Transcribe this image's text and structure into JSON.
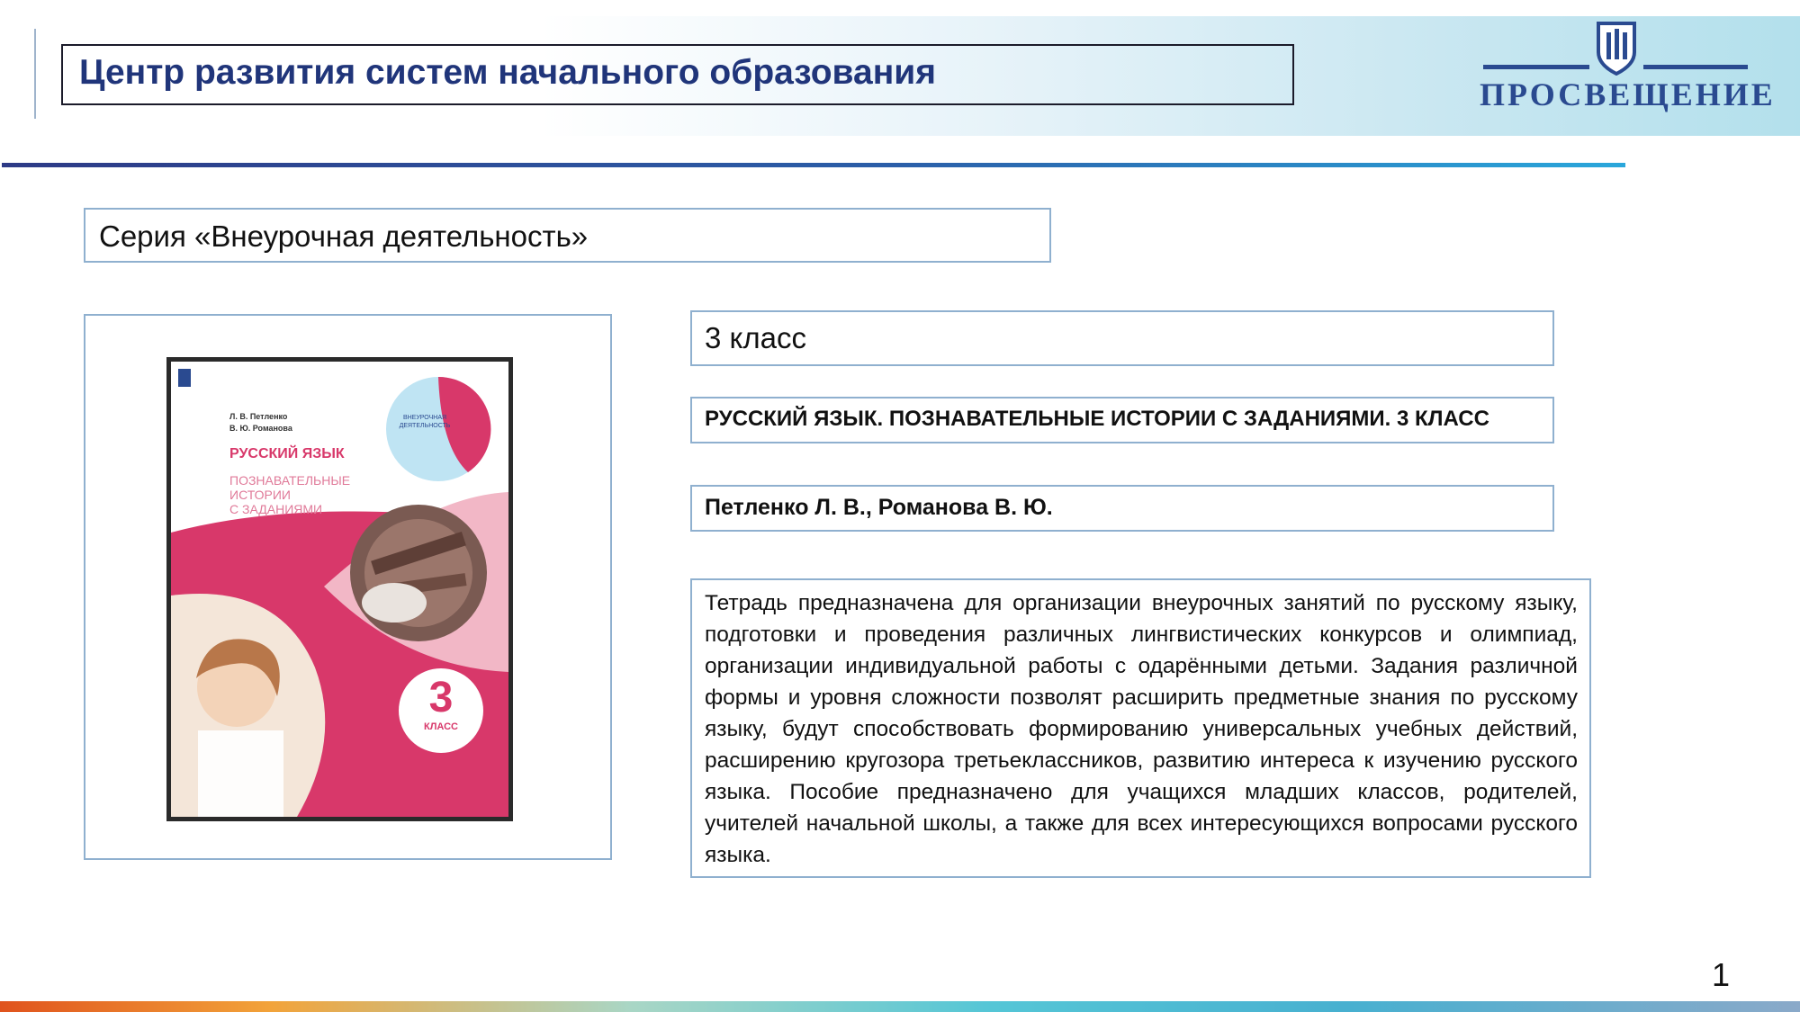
{
  "header": {
    "title": "Центр развития систем начального образования",
    "logo_text": "ПРОСВЕЩЕНИЕ"
  },
  "series": {
    "label": "Серия «Внеурочная деятельность»"
  },
  "book": {
    "grade": "3 класс",
    "title": "РУССКИЙ ЯЗЫК. ПОЗНАВАТЕЛЬНЫЕ ИСТОРИИ С ЗАДАНИЯМИ. 3 КЛАСС",
    "authors": "Петленко Л. В., Романова В. Ю.",
    "description": "Тетрадь предназначена для организации внеурочных занятий по русскому языку, подготовки и проведения различных лингвистических конкурсов и олимпиад, организации индивидуальной работы с одарёнными детьми. Задания различной формы и уровня сложности позволят расширить предметные знания по русскому языку, будут способствовать формированию универсальных учебных действий, расширению кругозора третьеклассников, развитию интереса к изучению русского языка. Пособие предназначено для учащихся младших классов, родителей, учителей начальной школы, а также для всех интересующихся вопросами русского языка."
  },
  "cover": {
    "authors_line1": "Л. В. Петленко",
    "authors_line2": "В. Ю. Романова",
    "subject": "РУССКИЙ ЯЗЫК",
    "subtitle_line1": "ПОЗНАВАТЕЛЬНЫЕ",
    "subtitle_line2": "ИСТОРИИ",
    "subtitle_line3": "С ЗАДАНИЯМИ",
    "badge_line1": "ВНЕУРОЧНАЯ",
    "badge_line2": "ДЕЯТЕЛЬНОСТЬ",
    "grade_number": "3",
    "grade_word": "класс"
  },
  "page": {
    "number": "1"
  },
  "colors": {
    "title_blue": "#20357a",
    "accent_pink": "#d8386a",
    "frame_border": "#8fb0cf"
  }
}
